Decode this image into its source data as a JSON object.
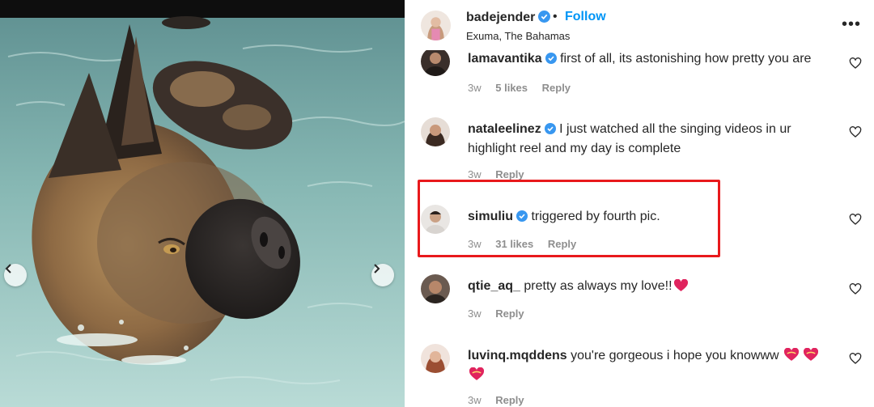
{
  "post": {
    "author": "badejender",
    "follow_label": "Follow",
    "separator": "•",
    "location": "Exuma, The Bahamas",
    "more_label": "•••"
  },
  "carousel": {
    "prev_icon": "chevron-left-icon",
    "next_icon": "chevron-right-icon"
  },
  "comments": [
    {
      "user": "lamavantika",
      "text": "first of all, its astonishing how pretty you are",
      "time": "3w",
      "likes": "5 likes",
      "reply": "Reply",
      "verified": true
    },
    {
      "user": "nataleelinez",
      "text": "I just watched all the singing videos in ur highlight reel and my day is complete",
      "time": "3w",
      "likes": "",
      "reply": "Reply",
      "verified": true
    },
    {
      "user": "simuliu",
      "text": "triggered by fourth pic.",
      "time": "3w",
      "likes": "31 likes",
      "reply": "Reply",
      "verified": true
    },
    {
      "user": "qtie_aq_",
      "text": "pretty as always my love!!",
      "time": "3w",
      "likes": "",
      "reply": "Reply",
      "verified": false
    },
    {
      "user": "luvinq.mqddens",
      "text": "you're gorgeous i hope you knowww",
      "time": "3w",
      "likes": "",
      "reply": "Reply",
      "verified": false
    }
  ],
  "colors": {
    "accent": "#0095f6",
    "highlight_box": "#e8191c",
    "verified": "#3897f0",
    "heart_emoji": "#e0245e"
  }
}
